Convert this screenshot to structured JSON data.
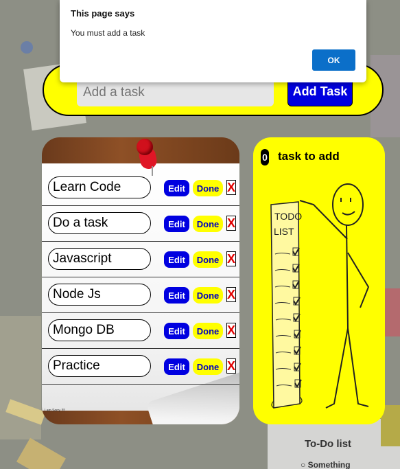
{
  "dialog": {
    "title": "This page says",
    "message": "You must add a task",
    "ok_label": "OK"
  },
  "add_bar": {
    "placeholder": "Add a task",
    "button_label": "Add Task"
  },
  "tasks": [
    {
      "text": "Learn Code",
      "edit": "Edit",
      "done": "Done",
      "delete": "X"
    },
    {
      "text": "Do a task",
      "edit": "Edit",
      "done": "Done",
      "delete": "X"
    },
    {
      "text": "Javascript",
      "edit": "Edit",
      "done": "Done",
      "delete": "X"
    },
    {
      "text": "Node Js",
      "edit": "Edit",
      "done": "Done",
      "delete": "X"
    },
    {
      "text": "Mongo DB",
      "edit": "Edit",
      "done": "Done",
      "delete": "X"
    },
    {
      "text": "Practice",
      "edit": "Edit",
      "done": "Done",
      "delete": "X"
    }
  ],
  "footer_note": "I am Sorry !!!!",
  "right_panel": {
    "counter": "0",
    "title": "task to add",
    "illustration_text": "TODO LIST"
  },
  "background": {
    "title": "To-Do list",
    "subtitle": "Something"
  },
  "colors": {
    "accent_yellow": "#ffff00",
    "button_blue": "#0000e0",
    "dialog_blue": "#0b6fc9",
    "delete_red": "#e10000"
  }
}
